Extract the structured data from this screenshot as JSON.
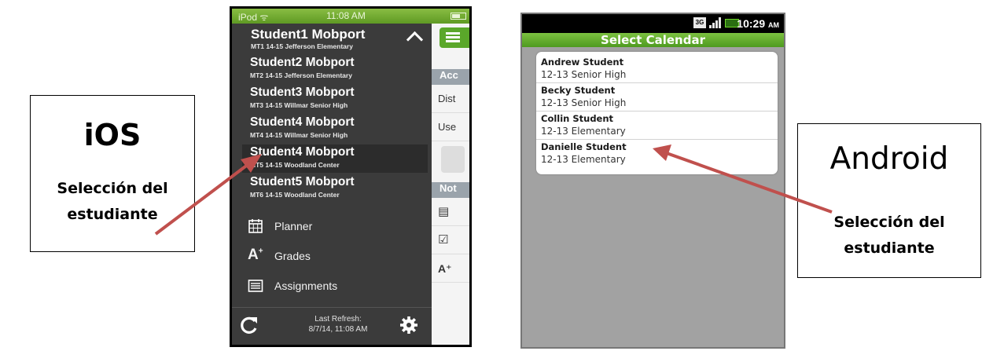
{
  "ios_label": {
    "platform": "iOS",
    "caption_line1": "Selección del",
    "caption_line2": "estudiante"
  },
  "android_label": {
    "platform": "Android",
    "caption_line1": "Selección del",
    "caption_line2": "estudiante"
  },
  "ios": {
    "status": {
      "carrier": "iPod",
      "time": "11:08 AM"
    },
    "current_student": {
      "name": "Student1 Mobport",
      "detail": "MT1 14-15 Jefferson Elementary"
    },
    "students": [
      {
        "name": "Student2 Mobport",
        "detail": "MT2 14-15 Jefferson Elementary"
      },
      {
        "name": "Student3 Mobport",
        "detail": "MT3 14-15 Willmar Senior High"
      },
      {
        "name": "Student4 Mobport",
        "detail": "MT4 14-15 Willmar Senior High"
      },
      {
        "name": "Student4 Mobport",
        "detail": "MT5 14-15 Woodland Center"
      },
      {
        "name": "Student5 Mobport",
        "detail": "MT6 14-15 Woodland Center"
      }
    ],
    "menu": [
      {
        "label": "Planner",
        "icon": "calendar-icon"
      },
      {
        "label": "Grades",
        "icon": "grades-icon",
        "glyph": "A",
        "sup": "+"
      },
      {
        "label": "Assignments",
        "icon": "list-icon"
      }
    ],
    "bottom": {
      "refresh_line1": "Last Refresh:",
      "refresh_line2": "8/7/14, 11:08 AM"
    },
    "behind": {
      "header1": "Acc",
      "row1": "Dist",
      "row2": "Use",
      "header2": "Not"
    },
    "colors": {
      "status_green": "#6ba82e",
      "drawer": "#3b3b3b",
      "menu_button": "#5aa72a"
    }
  },
  "android": {
    "status": {
      "time": "10:29",
      "ampm": "AM",
      "network": "3G"
    },
    "title": "Select Calendar",
    "items": [
      {
        "name": "Andrew Student",
        "school": "12-13 Senior High"
      },
      {
        "name": "Becky Student",
        "school": "12-13 Senior High"
      },
      {
        "name": "Collin Student",
        "school": "12-13 Elementary"
      },
      {
        "name": "Danielle Student",
        "school": "12-13 Elementary"
      }
    ],
    "colors": {
      "title_bar": "#62ab2c",
      "background": "#a2a2a2"
    }
  },
  "annotation": {
    "arrow_color": "#c0504d"
  }
}
